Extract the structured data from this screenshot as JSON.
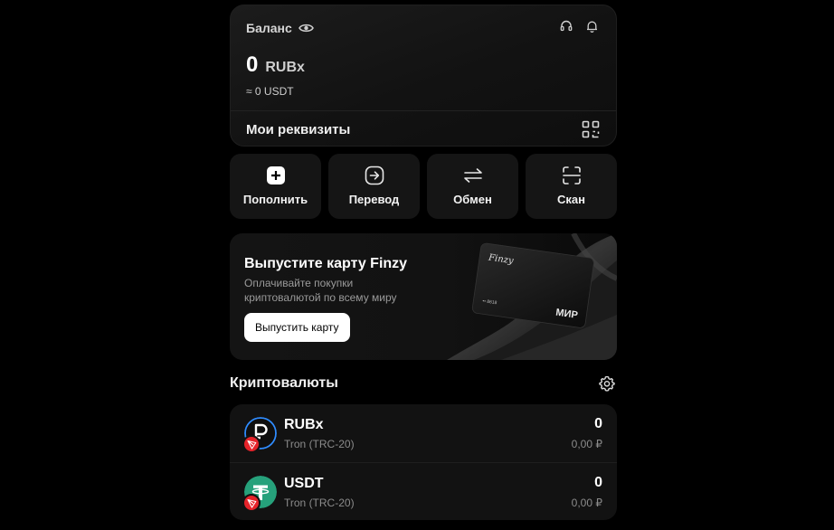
{
  "balance": {
    "label": "Баланс",
    "amount": "0",
    "currency": "RUBx",
    "approx": "≈ 0 USDT",
    "requisites_label": "Мои реквизиты"
  },
  "actions": [
    {
      "label": "Пополнить",
      "icon": "plus-icon"
    },
    {
      "label": "Перевод",
      "icon": "transfer-arrow-icon"
    },
    {
      "label": "Обмен",
      "icon": "exchange-icon"
    },
    {
      "label": "Скан",
      "icon": "scan-icon"
    }
  ],
  "promo": {
    "title": "Выпустите карту Finzy",
    "subtitle": "Оплачивайте покупки криптовалютой по всему миру",
    "button": "Выпустить карту",
    "card_brand": "Finzy",
    "card_number": "•• 8618",
    "card_network": "МИР"
  },
  "crypto": {
    "title": "Криптовалюты",
    "items": [
      {
        "name": "RUBx",
        "network": "Tron (TRC-20)",
        "amount": "0",
        "fiat": "0,00 ₽",
        "color": "#1a1a1a"
      },
      {
        "name": "USDT",
        "network": "Tron (TRC-20)",
        "amount": "0",
        "fiat": "0,00 ₽",
        "color": "#26a17b"
      }
    ]
  },
  "colors": {
    "background": "#000000",
    "card": "#151515",
    "tron_red": "#e5232a",
    "tether_green": "#26a17b",
    "rubx_blue": "#2f8cff"
  }
}
